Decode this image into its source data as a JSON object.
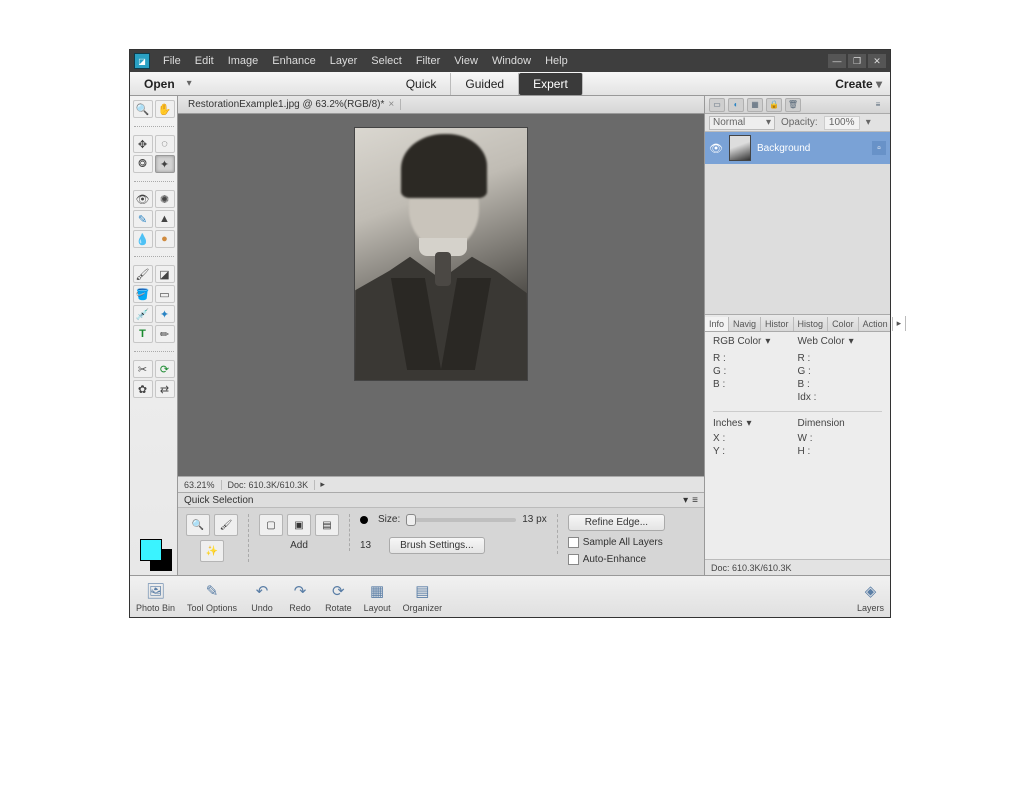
{
  "menubar": [
    "File",
    "Edit",
    "Image",
    "Enhance",
    "Layer",
    "Select",
    "Filter",
    "View",
    "Window",
    "Help"
  ],
  "modebar": {
    "open": "Open",
    "create": "Create",
    "tabs": [
      "Quick",
      "Guided",
      "Expert"
    ],
    "active": "Expert"
  },
  "doc_tab": "RestorationExample1.jpg @ 63.2%(RGB/8)*",
  "status": {
    "zoom": "63.21%",
    "doc": "Doc: 610.3K/610.3K"
  },
  "tooloptions": {
    "title": "Quick Selection",
    "add_label": "Add",
    "size_label": "Size:",
    "size_val": "13 px",
    "brush_settings": "Brush Settings...",
    "refine": "Refine Edge...",
    "sample_all": "Sample All Layers",
    "auto_enhance": "Auto-Enhance",
    "size_num": "13"
  },
  "layers": {
    "blend": "Normal",
    "opacity_label": "Opacity:",
    "opacity_val": "100%",
    "row_name": "Background"
  },
  "info_tabs": [
    "Info",
    "Navig",
    "Histor",
    "Histog",
    "Color",
    "Action"
  ],
  "info": {
    "rgb_label": "RGB Color",
    "web_label": "Web Color",
    "R": "R :",
    "G": "G :",
    "B": "B :",
    "Idx": "Idx :",
    "inches": "Inches",
    "dimension": "Dimension",
    "X": "X :",
    "Y": "Y :",
    "W": "W :",
    "H": "H :",
    "doc": "Doc: 610.3K/610.3K"
  },
  "bottombar": {
    "photo_bin": "Photo Bin",
    "tool_options": "Tool Options",
    "undo": "Undo",
    "redo": "Redo",
    "rotate": "Rotate",
    "layout": "Layout",
    "organizer": "Organizer",
    "layers": "Layers"
  }
}
